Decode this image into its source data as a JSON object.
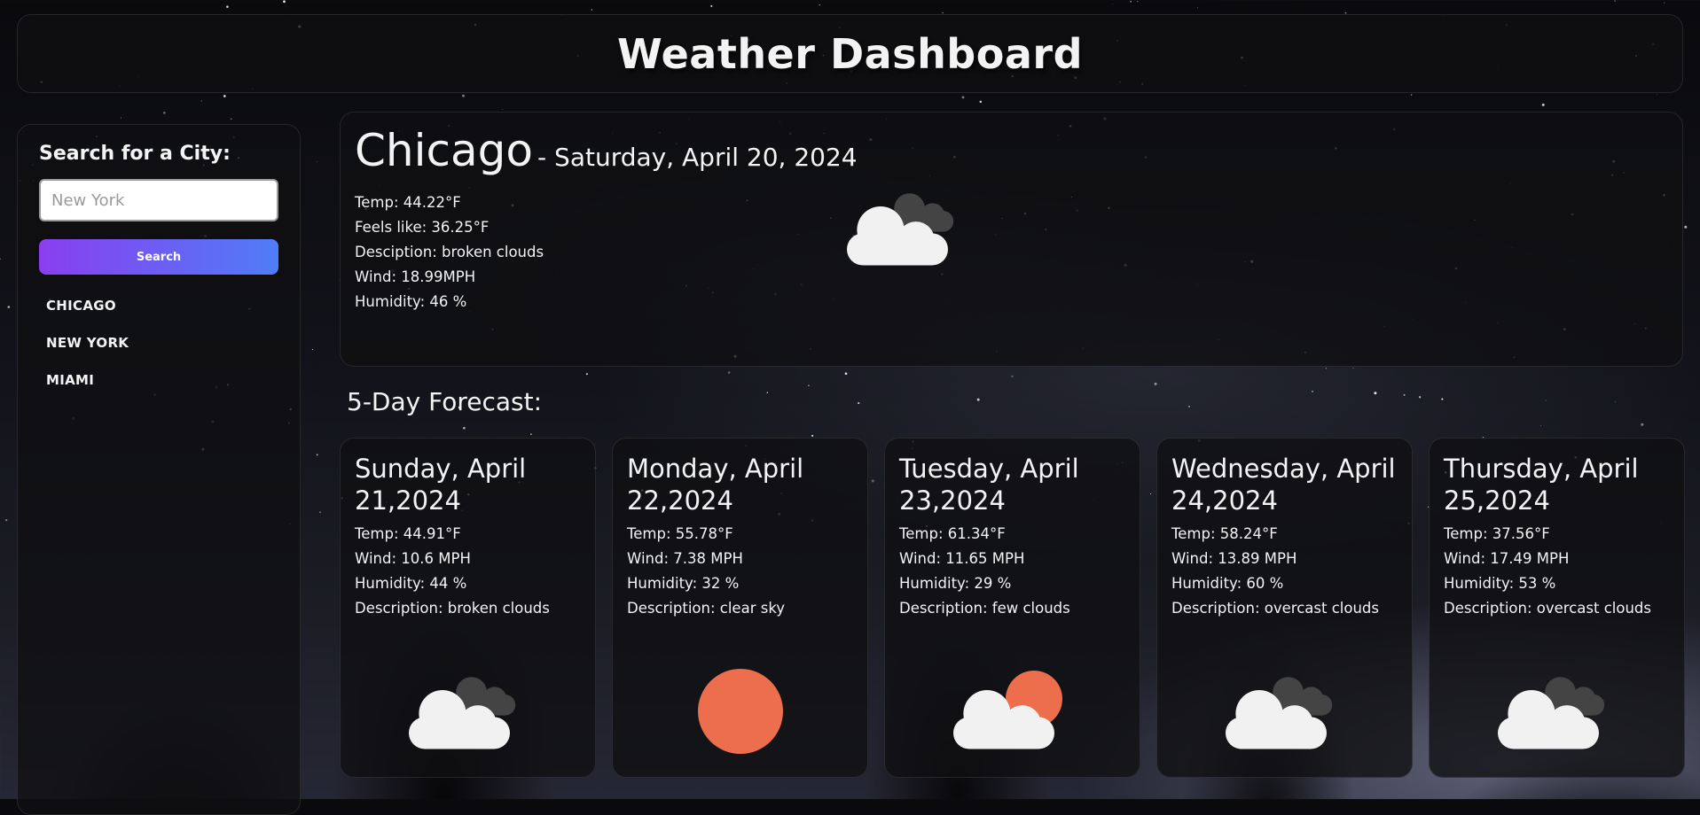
{
  "header": {
    "title": "Weather Dashboard"
  },
  "sidebar": {
    "heading": "Search for a City:",
    "search_placeholder": "New York",
    "search_label": "Search",
    "history": [
      "CHICAGO",
      "NEW YORK",
      "MIAMI"
    ]
  },
  "current": {
    "city": "Chicago",
    "date": "- Saturday, April 20, 2024",
    "temp": "Temp: 44.22°F",
    "feels": "Feels like: 36.25°F",
    "desc": "Desciption: broken clouds",
    "wind": "Wind: 18.99MPH",
    "humidity": "Humidity: 46 %",
    "icon": "broken-clouds-icon"
  },
  "forecast": {
    "title": "5-Day Forecast:",
    "days": [
      {
        "date_line1": "Sunday, April",
        "date_line2": "21,2024",
        "temp": "Temp: 44.91°F",
        "wind": "Wind: 10.6 MPH",
        "humidity": "Humidity: 44 %",
        "desc": "Description: broken clouds",
        "icon": "broken-clouds-icon"
      },
      {
        "date_line1": "Monday, April",
        "date_line2": "22,2024",
        "temp": "Temp: 55.78°F",
        "wind": "Wind: 7.38 MPH",
        "humidity": "Humidity: 32 %",
        "desc": "Description: clear sky",
        "icon": "clear-sky-icon"
      },
      {
        "date_line1": "Tuesday, April",
        "date_line2": "23,2024",
        "temp": "Temp: 61.34°F",
        "wind": "Wind: 11.65 MPH",
        "humidity": "Humidity: 29 %",
        "desc": "Description: few clouds",
        "icon": "few-clouds-icon"
      },
      {
        "date_line1": "Wednesday, April",
        "date_line2": "24,2024",
        "temp": "Temp: 58.24°F",
        "wind": "Wind: 13.89 MPH",
        "humidity": "Humidity: 60 %",
        "desc": "Description: overcast clouds",
        "icon": "overcast-clouds-icon"
      },
      {
        "date_line1": "Thursday, April",
        "date_line2": "25,2024",
        "temp": "Temp: 37.56°F",
        "wind": "Wind: 17.49 MPH",
        "humidity": "Humidity: 53 %",
        "desc": "Description: overcast clouds",
        "icon": "overcast-clouds-icon"
      }
    ]
  },
  "colors": {
    "sun": "#ec6e4c",
    "cloud_light": "#f1f1f1",
    "cloud_dark": "#444444",
    "button_start": "#8a3ef0",
    "button_end": "#4f7df7"
  }
}
